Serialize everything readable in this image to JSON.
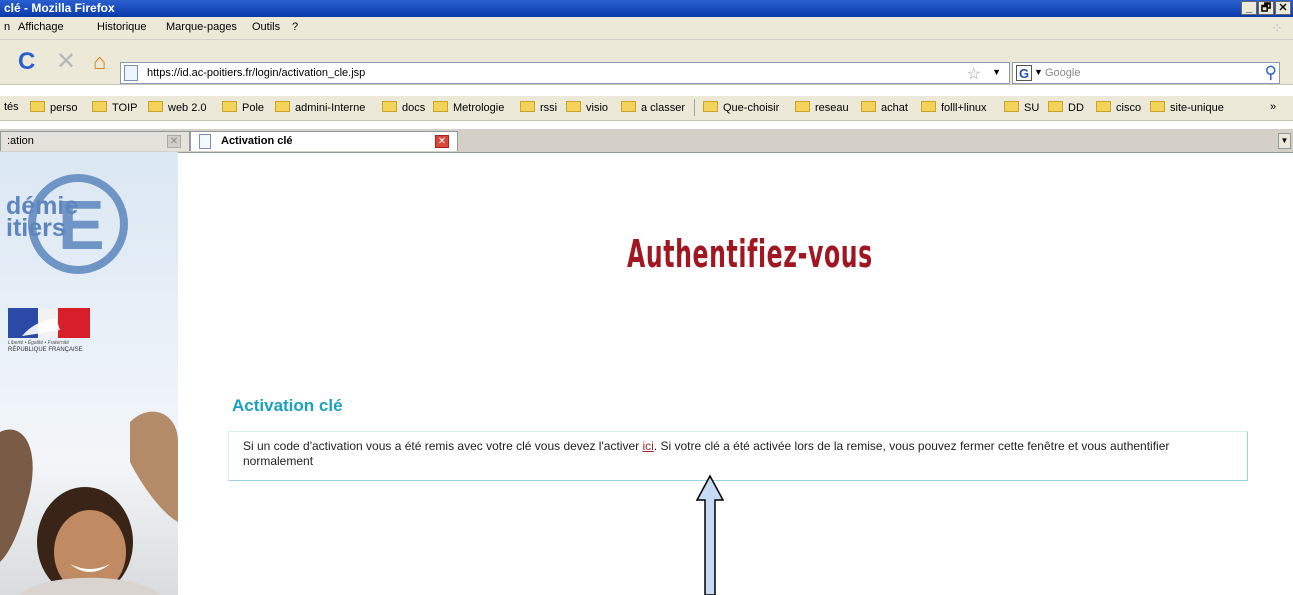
{
  "window": {
    "title": "clé - Mozilla Firefox",
    "buttons": [
      "_",
      "🗗",
      "✕"
    ]
  },
  "menubar": {
    "items": [
      "n",
      "Affichage",
      "Historique",
      "Marque-pages",
      "Outils",
      "?"
    ]
  },
  "navbar": {
    "url": "https://id.ac-poitiers.fr/login/activation_cle.jsp",
    "search_placeholder": "Google"
  },
  "bookmarks": {
    "first": "tés",
    "folders": [
      "perso",
      "TOIP",
      "web 2.0",
      "Pole",
      "admini-Interne",
      "docs",
      "Metrologie",
      "rssi",
      "visio",
      "a classer"
    ],
    "folders2": [
      "Que-choisir",
      "reseau",
      "achat",
      "folll+linux",
      "SU",
      "DD",
      "cisco",
      "site-unique"
    ],
    "overflow": "»"
  },
  "tabs": [
    {
      "label": ":ation",
      "active": false
    },
    {
      "label": "Activation clé",
      "active": true
    }
  ],
  "sidebar": {
    "logo_line1": "démie",
    "logo_line2": "itiers",
    "logo_letter": "E",
    "motto": "Liberté • Égalité • Fraternité",
    "republic": "RÉPUBLIQUE FRANÇAISE"
  },
  "page": {
    "title": "Authentifiez-vous",
    "heading": "Activation clé",
    "text_before": "Si un code d'activation vous a été remis avec votre clé vous devez l'activer ",
    "link": "ici",
    "text_after": ". Si votre clé a été activée lors de la remise, vous pouvez fermer cette fenêtre et vous authentifier normalement"
  },
  "colors": {
    "title_red": "#a01722",
    "heading_teal": "#1aa1bf",
    "arrow_fill": "#c5dbf5"
  }
}
